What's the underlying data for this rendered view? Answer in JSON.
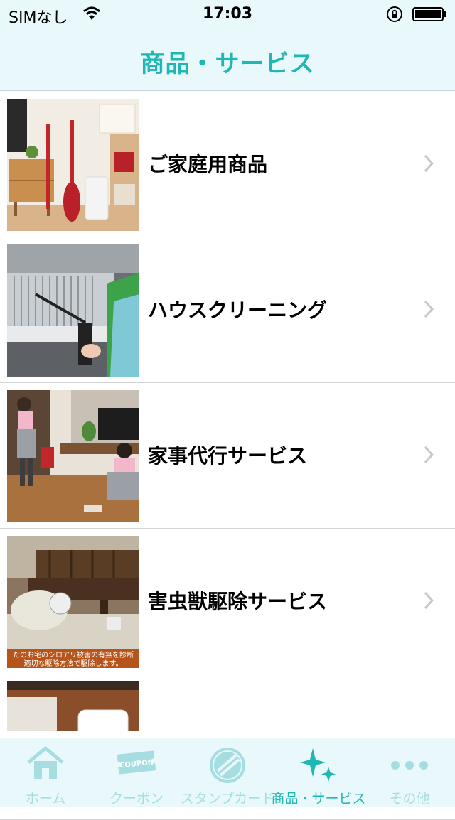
{
  "status_bar": {
    "carrier": "SIMなし",
    "time": "17:03"
  },
  "header": {
    "title": "商品・サービス"
  },
  "items": [
    {
      "label": "ご家庭用商品"
    },
    {
      "label": "ハウスクリーニング"
    },
    {
      "label": "家事代行サービス"
    },
    {
      "label": "害虫獣駆除サービス"
    },
    {
      "label": ""
    }
  ],
  "thumbnail_caption": "たのお宅のシロアリ被害の有無を診断\n適切な駆除方法で駆除します。",
  "coupon_icon_text": "COUPON",
  "tabs": [
    {
      "label": "ホーム",
      "icon": "home-icon"
    },
    {
      "label": "クーポン",
      "icon": "coupon-icon"
    },
    {
      "label": "スタンプカード",
      "icon": "stamp-card-icon"
    },
    {
      "label": "商品・サービス",
      "icon": "sparkle-icon",
      "active": true
    },
    {
      "label": "その他",
      "icon": "more-icon"
    }
  ],
  "colors": {
    "accent": "#1fb7b4",
    "bar_background": "#e8f8fb",
    "inactive_tab": "#a6dde0"
  }
}
